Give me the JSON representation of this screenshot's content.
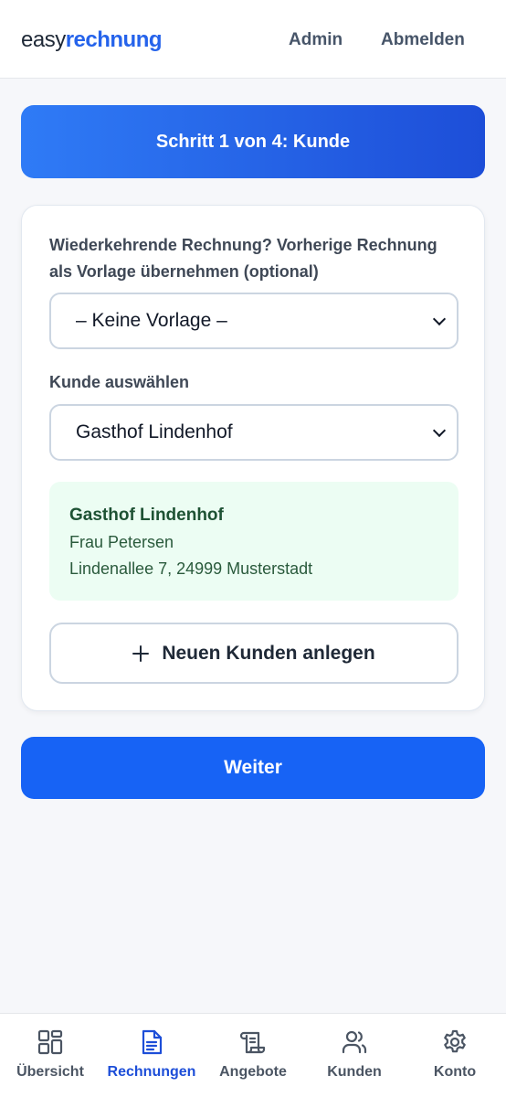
{
  "header": {
    "logo_part1": "easy",
    "logo_part2": "rechnung",
    "nav_admin": "Admin",
    "nav_logout": "Abmelden"
  },
  "step": {
    "title": "Schritt 1 von 4: Kunde"
  },
  "form": {
    "template_label": "Wiederkehrende Rechnung? Vorherige Rechnung als Vorlage übernehmen (optional)",
    "template_value": "– Keine Vorlage –",
    "customer_label": "Kunde auswählen",
    "customer_value": "Gasthof Lindenhof",
    "customer_info": {
      "name": "Gasthof Lindenhof",
      "contact": "Frau Petersen",
      "address": "Lindenallee 7, 24999 Musterstadt"
    },
    "new_customer_label": "Neuen Kunden anlegen"
  },
  "actions": {
    "continue_label": "Weiter"
  },
  "bottom_nav": {
    "items": [
      {
        "label": "Übersicht",
        "icon": "grid-icon"
      },
      {
        "label": "Rechnungen",
        "icon": "document-icon",
        "active": true
      },
      {
        "label": "Angebote",
        "icon": "scroll-icon"
      },
      {
        "label": "Kunden",
        "icon": "users-icon"
      },
      {
        "label": "Konto",
        "icon": "gear-icon"
      }
    ]
  },
  "colors": {
    "primary": "#1763f5",
    "active_tab": "#1d4ed8",
    "info_bg": "#ecfdf3"
  }
}
